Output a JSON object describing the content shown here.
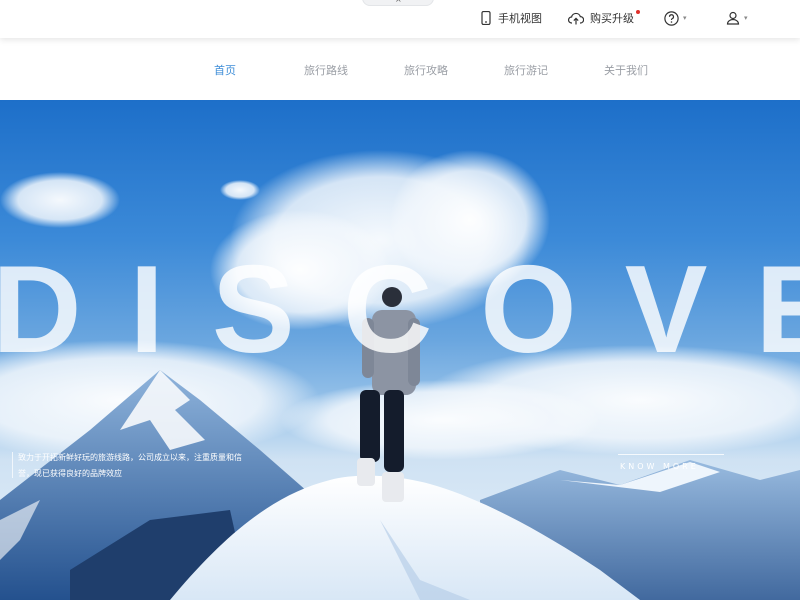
{
  "toolbar": {
    "mobile_view": "手机视图",
    "upgrade": "购买升级",
    "close_icon": "×",
    "icons": [
      "phone-icon",
      "cloud-upload-icon",
      "help-icon",
      "user-icon"
    ]
  },
  "nav": {
    "items": [
      {
        "label": "首页",
        "active": true
      },
      {
        "label": "旅行路线",
        "active": false
      },
      {
        "label": "旅行攻略",
        "active": false
      },
      {
        "label": "旅行游记",
        "active": false
      },
      {
        "label": "关于我们",
        "active": false
      }
    ]
  },
  "hero": {
    "headline": "DISCOVER",
    "description": "致力于开拓新鲜好玩的旅游线路，公司成立以来，注重质量和信誉，现已获得良好的品牌效应",
    "cta": "KNOW MORE"
  },
  "colors": {
    "accent": "#3f8ed8",
    "nav_inactive": "#9a9ea5",
    "notification": "#e0302b"
  }
}
